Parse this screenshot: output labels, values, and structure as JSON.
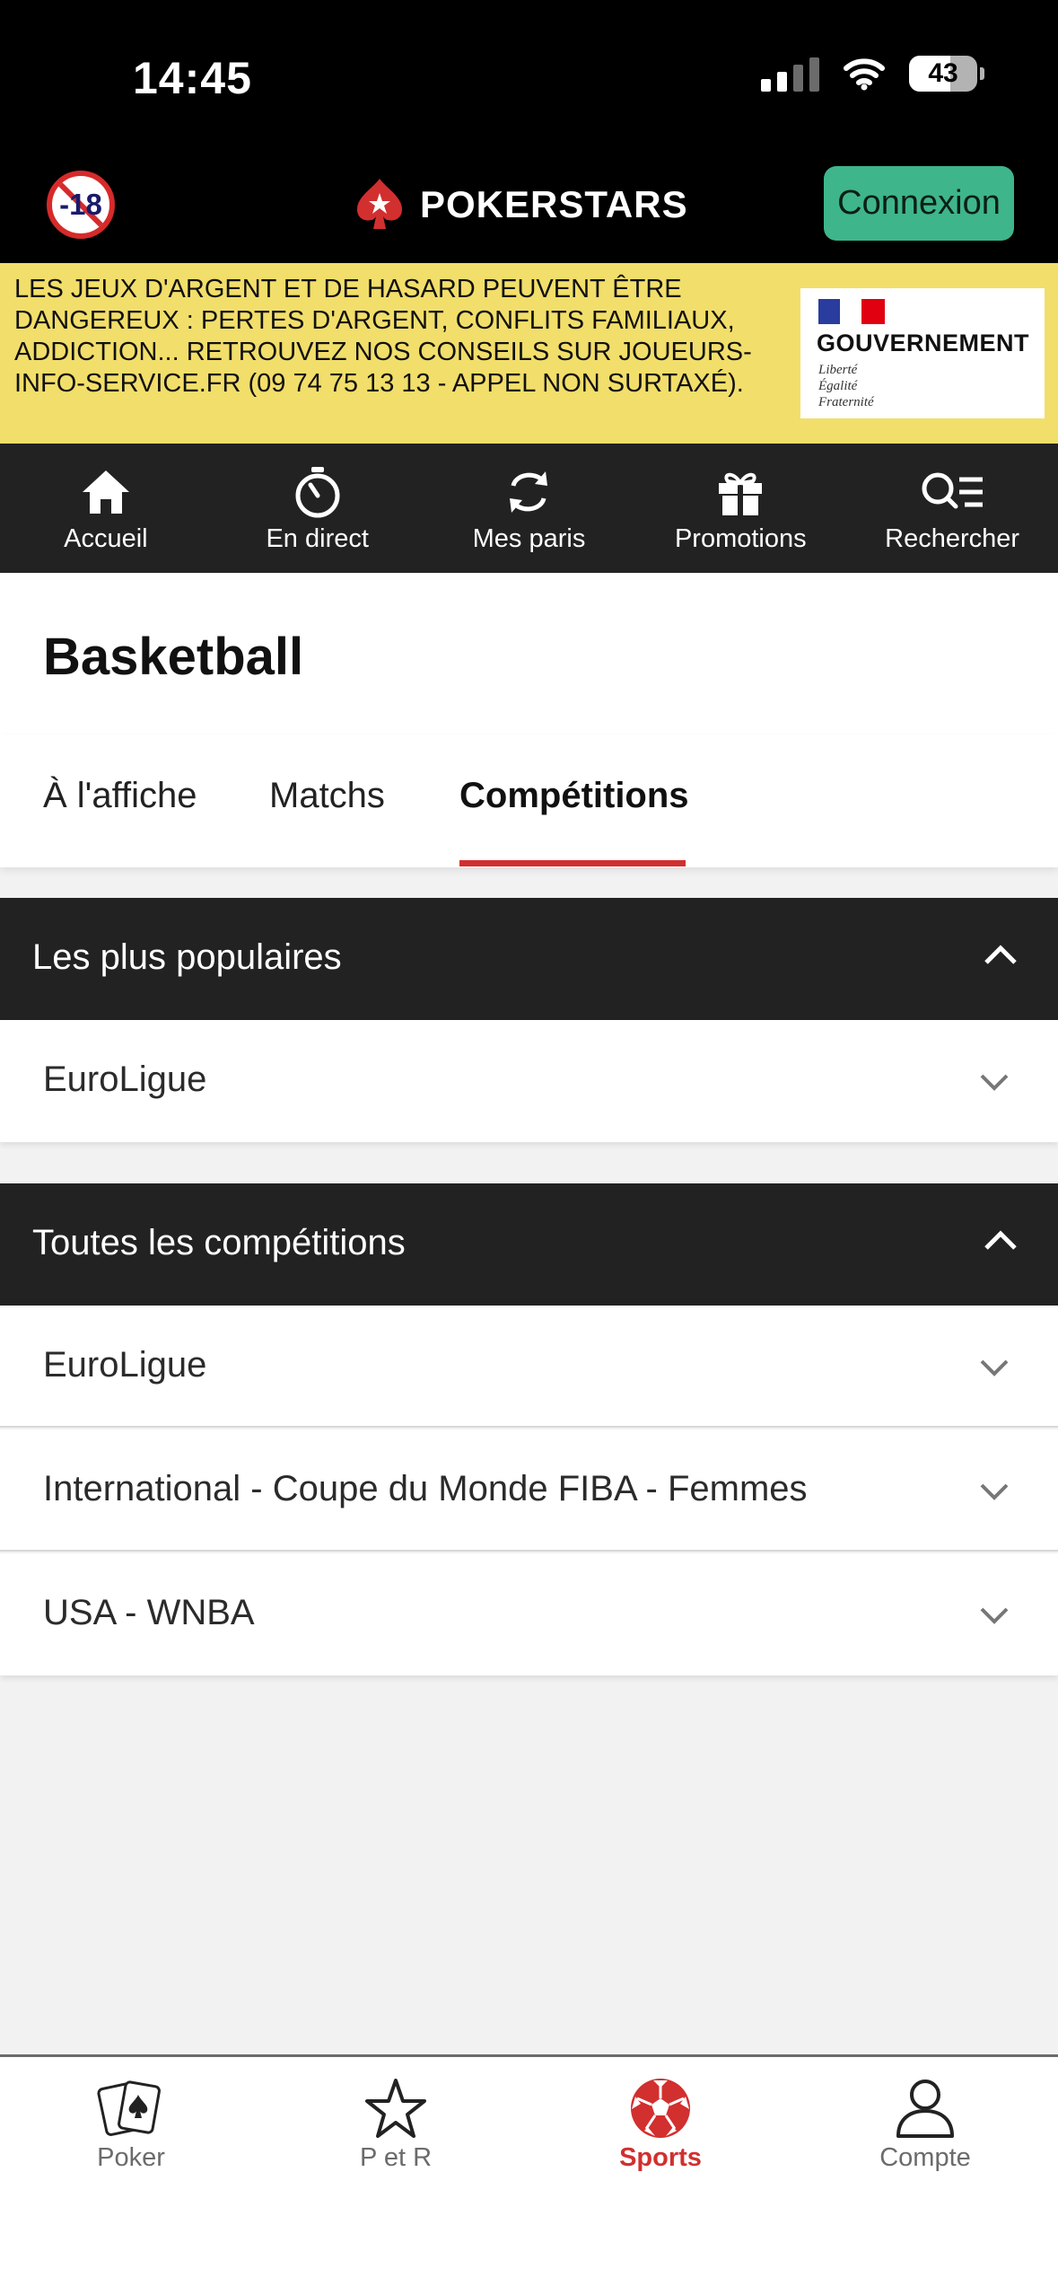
{
  "status_bar": {
    "time": "14:45",
    "battery": "43",
    "battery_level": 0.43
  },
  "header": {
    "age_badge": "-18",
    "brand": "POKERSTARS",
    "login_label": "Connexion",
    "brand_color": "#d22f2f",
    "login_color": "#3fb58b"
  },
  "warning": {
    "text": "LES JEUX D'ARGENT ET DE HASARD PEUVENT ÊTRE DANGEREUX : PERTES D'ARGENT, CONFLITS FAMILIAUX, ADDICTION... RETROUVEZ NOS CONSEILS SUR JOUEURS-INFO-SERVICE.FR (09 74 75 13 13 - APPEL NON SURTAXÉ).",
    "gov_name": "GOUVERNEMENT",
    "gov_motto_1": "Liberté",
    "gov_motto_2": "Égalité",
    "gov_motto_3": "Fraternité",
    "background": "#f2de6a"
  },
  "top_nav": {
    "items": [
      {
        "label": "Accueil",
        "icon": "home-icon"
      },
      {
        "label": "En direct",
        "icon": "stopwatch-icon"
      },
      {
        "label": "Mes paris",
        "icon": "refresh-arrows-icon"
      },
      {
        "label": "Promotions",
        "icon": "gift-icon"
      },
      {
        "label": "Rechercher",
        "icon": "search-list-icon"
      }
    ]
  },
  "page": {
    "title": "Basketball"
  },
  "tabs": {
    "items": [
      {
        "label": "À l'affiche"
      },
      {
        "label": "Matchs"
      },
      {
        "label": "Compétitions",
        "active": true
      }
    ]
  },
  "sections": [
    {
      "title": "Les plus populaires",
      "expanded": true,
      "items": [
        {
          "label": "EuroLigue"
        }
      ]
    },
    {
      "title": "Toutes les compétitions",
      "expanded": true,
      "items": [
        {
          "label": "EuroLigue"
        },
        {
          "label": "International - Coupe du Monde FIBA - Femmes"
        },
        {
          "label": "USA - WNBA"
        }
      ]
    }
  ],
  "bottom_nav": {
    "items": [
      {
        "label": "Poker",
        "icon": "cards-icon"
      },
      {
        "label": "P et R",
        "icon": "star-icon"
      },
      {
        "label": "Sports",
        "icon": "soccer-ball-icon",
        "active": true
      },
      {
        "label": "Compte",
        "icon": "user-icon"
      }
    ],
    "active_color": "#d22f2f"
  }
}
